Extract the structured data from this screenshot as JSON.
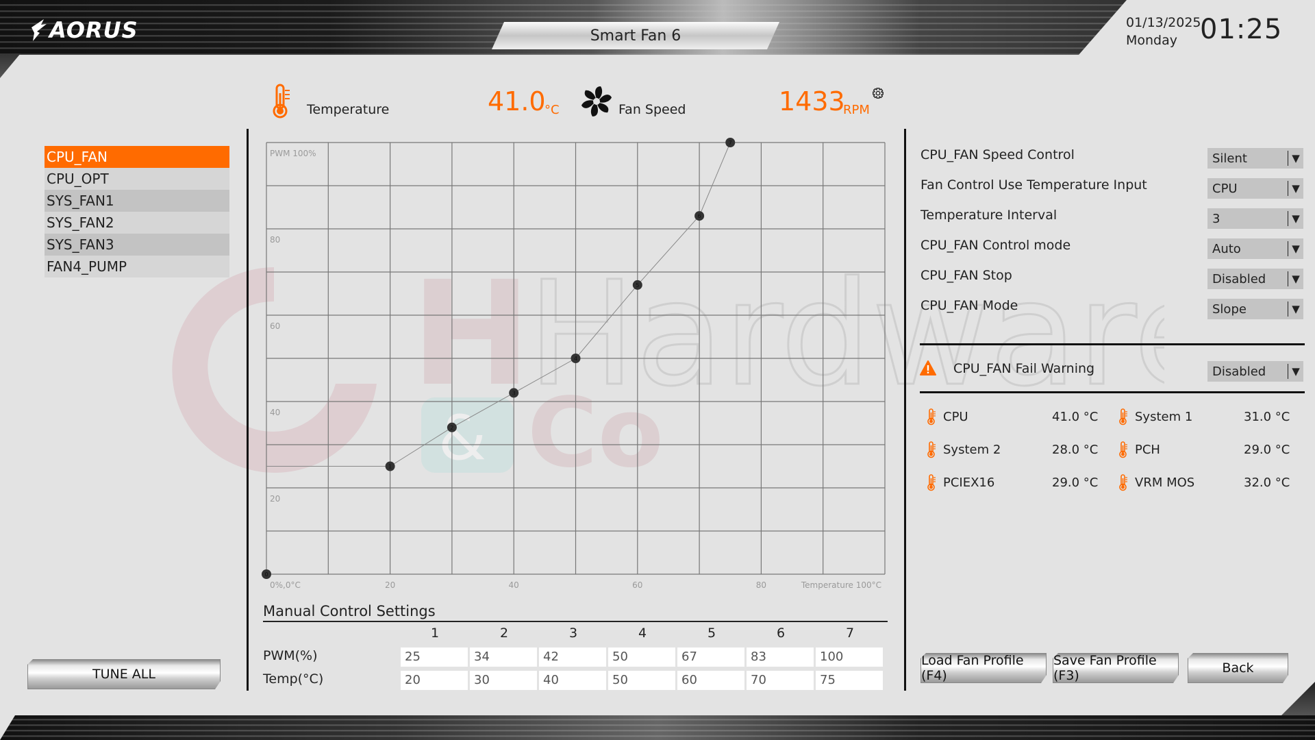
{
  "header": {
    "logo": "AORUS",
    "title": "Smart Fan 6",
    "date": "01/13/2025",
    "day": "Monday",
    "time": "01:25"
  },
  "readouts": {
    "temperature_label": "Temperature",
    "temperature_value": "41.0",
    "temperature_unit": "°C",
    "fan_speed_label": "Fan Speed",
    "fan_speed_value": "1433",
    "fan_speed_unit": "RPM",
    "accent_color": "#ff6b00"
  },
  "fan_list": {
    "items": [
      {
        "label": "CPU_FAN",
        "active": true
      },
      {
        "label": "CPU_OPT",
        "active": false
      },
      {
        "label": "SYS_FAN1",
        "active": false
      },
      {
        "label": "SYS_FAN2",
        "active": false
      },
      {
        "label": "SYS_FAN3",
        "active": false
      },
      {
        "label": "FAN4_PUMP",
        "active": false
      }
    ],
    "tune_all_label": "TUNE ALL"
  },
  "chart_data": {
    "type": "line",
    "title": "",
    "xlabel": "Temperature 100°C",
    "ylabel": "PWM 100%",
    "origin_label": "0%,0°C",
    "xlim": [
      0,
      100
    ],
    "ylim": [
      0,
      100
    ],
    "x_ticks": [
      20,
      40,
      60,
      80
    ],
    "y_ticks": [
      20,
      40,
      60,
      80
    ],
    "grid": true,
    "points": [
      {
        "id": "0",
        "x": 0,
        "y": 0
      },
      {
        "id": "1",
        "x": 20,
        "y": 25
      },
      {
        "id": "2",
        "x": 30,
        "y": 34
      },
      {
        "id": "3",
        "x": 40,
        "y": 42
      },
      {
        "id": "4",
        "x": 50,
        "y": 50
      },
      {
        "id": "5",
        "x": 60,
        "y": 67
      },
      {
        "id": "6",
        "x": 70,
        "y": 83
      },
      {
        "id": "7",
        "x": 75,
        "y": 100
      }
    ]
  },
  "manual": {
    "title": "Manual Control Settings",
    "columns": [
      "1",
      "2",
      "3",
      "4",
      "5",
      "6",
      "7"
    ],
    "pwm_label": "PWM(%)",
    "temp_label": "Temp(°C)",
    "pwm": [
      "25",
      "34",
      "42",
      "50",
      "67",
      "83",
      "100"
    ],
    "temp": [
      "20",
      "30",
      "40",
      "50",
      "60",
      "70",
      "75"
    ]
  },
  "settings": [
    {
      "label": "CPU_FAN Speed Control",
      "value": "Silent"
    },
    {
      "label": "Fan Control Use Temperature Input",
      "value": "CPU"
    },
    {
      "label": "Temperature Interval",
      "value": "3"
    },
    {
      "label": "CPU_FAN Control mode",
      "value": "Auto"
    },
    {
      "label": "CPU_FAN Stop",
      "value": "Disabled"
    },
    {
      "label": "CPU_FAN Mode",
      "value": "Slope"
    }
  ],
  "fail_warning": {
    "label": "CPU_FAN Fail Warning",
    "value": "Disabled"
  },
  "sensors": [
    {
      "name": "CPU",
      "value": "41.0 °C"
    },
    {
      "name": "System 1",
      "value": "31.0 °C"
    },
    {
      "name": "System 2",
      "value": "28.0 °C"
    },
    {
      "name": "PCH",
      "value": "29.0 °C"
    },
    {
      "name": "PCIEX16",
      "value": "29.0 °C"
    },
    {
      "name": "VRM MOS",
      "value": "32.0 °C"
    }
  ],
  "buttons": {
    "load": "Load Fan Profile (F4)",
    "save": "Save Fan Profile (F3)",
    "back": "Back"
  },
  "watermark": {
    "text1": "Hardware",
    "text2": "Co",
    "amp": "&"
  }
}
